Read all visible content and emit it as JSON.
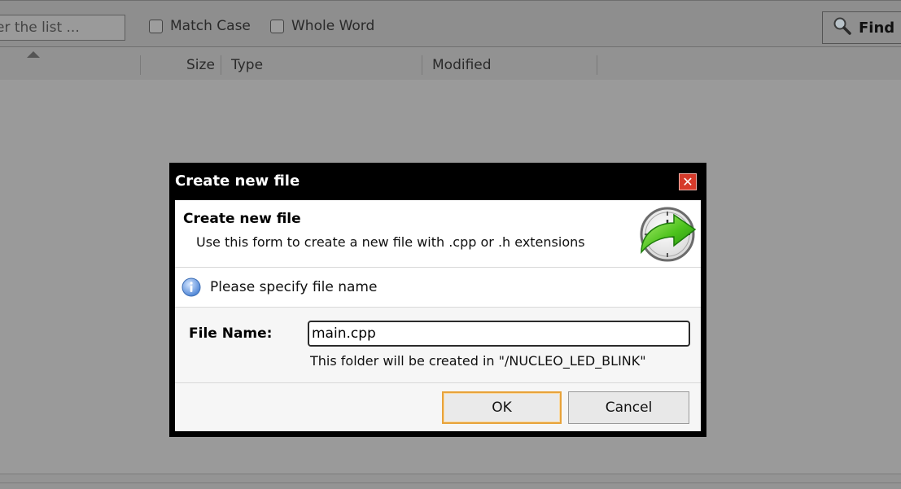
{
  "toolbar": {
    "filter_placeholder": "er the list ...",
    "match_case_label": "Match Case",
    "whole_word_label": "Whole Word",
    "find_label": "Find"
  },
  "columns": {
    "size": "Size",
    "type": "Type",
    "modified": "Modified"
  },
  "dialog": {
    "title": "Create new file",
    "close_glyph": "✕",
    "banner_title": "Create new file",
    "banner_desc": "Use this form to create a new file with .cpp or .h extensions",
    "banner_icon": "green-arrow-clock-icon",
    "info_icon": "info-icon",
    "info_text": "Please specify file name",
    "file_name_label": "File Name:",
    "file_name_value": "main.cpp",
    "hint": "This folder will be created in \"/NUCLEO_LED_BLINK\"",
    "ok_label": "OK",
    "cancel_label": "Cancel"
  },
  "colors": {
    "overlay": "#9a9a9a",
    "title_bar": "#000000",
    "close_button": "#d63b2b",
    "ok_focus_border": "#e8a33a"
  }
}
